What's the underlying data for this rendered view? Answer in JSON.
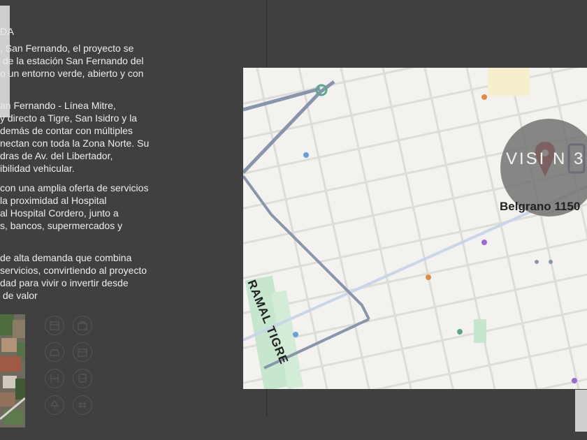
{
  "text_column": {
    "heading": "DA",
    "para1": ", San Fernando, el proyecto se\n de la estación San Fernando del\no un entorno verde, abierto y con",
    "para2": "an Fernando - Línea Mitre,\ny directo a Tigre, San Isidro y la\ndemás de contar con múltiples\nnectan con toda la Zona Norte. Su\ndras de Av. del Libertador,\nibilidad vehicular.",
    "para3": "con una amplia oferta de servicios\nla proximidad al Hospital\nal Hospital Cordero, junto a\ns, bancos, supermercados y",
    "para4": "de alta demanda que combina\nservicios, convirtiendo al proyecto\ndad para vivir o invertir desde\n de valor"
  },
  "amenities": [
    {
      "icon": "storefront-icon"
    },
    {
      "icon": "bag-icon"
    },
    {
      "icon": "car-icon"
    },
    {
      "icon": "building-icon"
    },
    {
      "icon": "hospital-icon"
    },
    {
      "icon": "bus-icon"
    },
    {
      "icon": "tree-icon"
    },
    {
      "icon": "train-icon"
    }
  ],
  "map": {
    "logo_text": "VISI  N 3",
    "address": "Belgrano 1150",
    "railway_label": "RAMAL TIGRE",
    "pin_color": "#c0282d",
    "route_color": "#8896ad"
  }
}
